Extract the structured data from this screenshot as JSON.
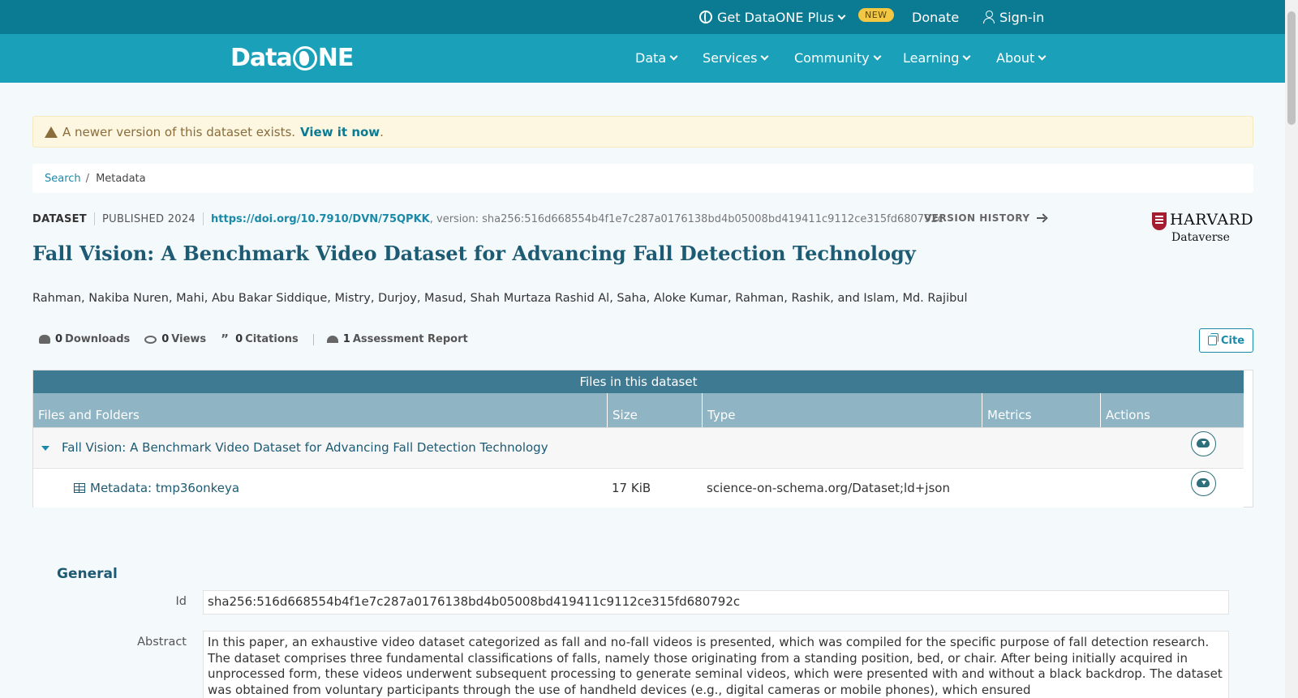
{
  "topbar": {
    "plus_label": "Get DataONE Plus",
    "new_badge": "NEW",
    "donate_label": "Donate",
    "signin_label": "Sign-in"
  },
  "nav": {
    "logo_left": "Data",
    "logo_right": "NE",
    "items": [
      "Data",
      "Services",
      "Community",
      "Learning",
      "About"
    ]
  },
  "alert": {
    "text": "A newer version of this dataset exists.",
    "link": "View it now",
    "trailing": "."
  },
  "breadcrumb": {
    "search": "Search",
    "separator": "/",
    "current": "Metadata"
  },
  "dataset": {
    "type_label": "DATASET",
    "published": "PUBLISHED 2024",
    "doi": "https://doi.org/10.7910/DVN/75QPKK",
    "version": ", version: sha256:516d668554b4f1e7c287a0176138bd4b05008bd419411c9112ce315fd680792c",
    "version_history": "VERSION HISTORY",
    "repository_line1": "HARVARD",
    "repository_line2": "Dataverse",
    "title": "Fall Vision: A Benchmark Video Dataset for Advancing Fall Detection Technology",
    "authors": "Rahman, Nakiba Nuren, Mahi, Abu Bakar Siddique, Mistry, Durjoy, Masud, Shah Murtaza Rashid Al, Saha, Aloke Kumar, Rahman, Rashik, and Islam, Md. Rajibul"
  },
  "metrics": {
    "downloads_count": "0",
    "downloads_label": "Downloads",
    "views_count": "0",
    "views_label": "Views",
    "citations_count": "0",
    "citations_label": "Citations",
    "assessment_count": "1",
    "assessment_label": "Assessment Report",
    "cite_label": "Cite"
  },
  "files_table": {
    "caption": "Files in this dataset",
    "headers": [
      "Files and Folders",
      "Size",
      "Type",
      "Metrics",
      "Actions"
    ],
    "folder_name": "Fall Vision: A Benchmark Video Dataset for Advancing Fall Detection Technology",
    "files": [
      {
        "name": "Metadata: tmp36onkeya",
        "size": "17 KiB",
        "type": "science-on-schema.org/Dataset;ld+json"
      }
    ]
  },
  "general": {
    "title": "General",
    "id_label": "Id",
    "id_value": "sha256:516d668554b4f1e7c287a0176138bd4b05008bd419411c9112ce315fd680792c",
    "abstract_label": "Abstract",
    "abstract_value": "In this paper, an exhaustive video dataset categorized as fall and no-fall videos is presented, which was compiled for the specific purpose of fall detection research. The dataset comprises three fundamental classifications of falls, namely those originating from a standing position, bed, or chair. After being initially acquired in unprocessed form, these videos underwent subsequent processing to generate seminal videos, which were presented with and without a black backdrop. The dataset was obtained from voluntary participants through the use of handheld devices (e.g., digital cameras or mobile phones), which ensured"
  },
  "colors": {
    "topbar": "#0b7b93",
    "navbar": "#1ba0ba",
    "title": "#1d5a73",
    "link": "#1a8aa8",
    "badge": "#f2c744"
  }
}
